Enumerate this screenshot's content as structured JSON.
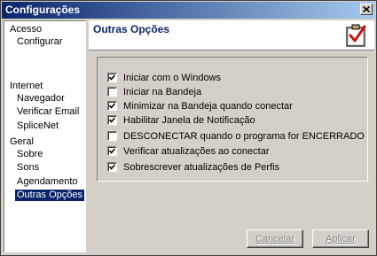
{
  "window": {
    "title": "Configurações"
  },
  "sidebar": {
    "items": [
      {
        "label": "Acesso"
      },
      {
        "label": "Configurar"
      },
      {
        "label": "Internet"
      },
      {
        "label": "Navegador"
      },
      {
        "label": "Verificar Email"
      },
      {
        "label": "SpliceNet"
      },
      {
        "label": "Geral"
      },
      {
        "label": "Sobre"
      },
      {
        "label": "Sons"
      },
      {
        "label": "Agendamento"
      },
      {
        "label": "Outras Opções"
      }
    ],
    "selected": "Outras Opções"
  },
  "header": {
    "title": "Outras Opções",
    "icon": "checklist-icon"
  },
  "options": [
    {
      "label": "Iniciar com o Windows",
      "checked": true
    },
    {
      "label": "Iniciar na Bandeja",
      "checked": false
    },
    {
      "label": "Minimizar na Bandeja quando conectar",
      "checked": true
    },
    {
      "label": "Habilitar Janela de Notificação",
      "checked": true
    },
    {
      "label": "DESCONECTAR quando o programa for ENCERRADO",
      "checked": false
    },
    {
      "label": "Verificar atualizações ao conectar",
      "checked": true
    },
    {
      "label": "Sobrescrever atualizações de Perfis",
      "checked": true
    }
  ],
  "buttons": {
    "cancel": "Cancelar",
    "apply": "Aplicar",
    "enabled": false
  }
}
